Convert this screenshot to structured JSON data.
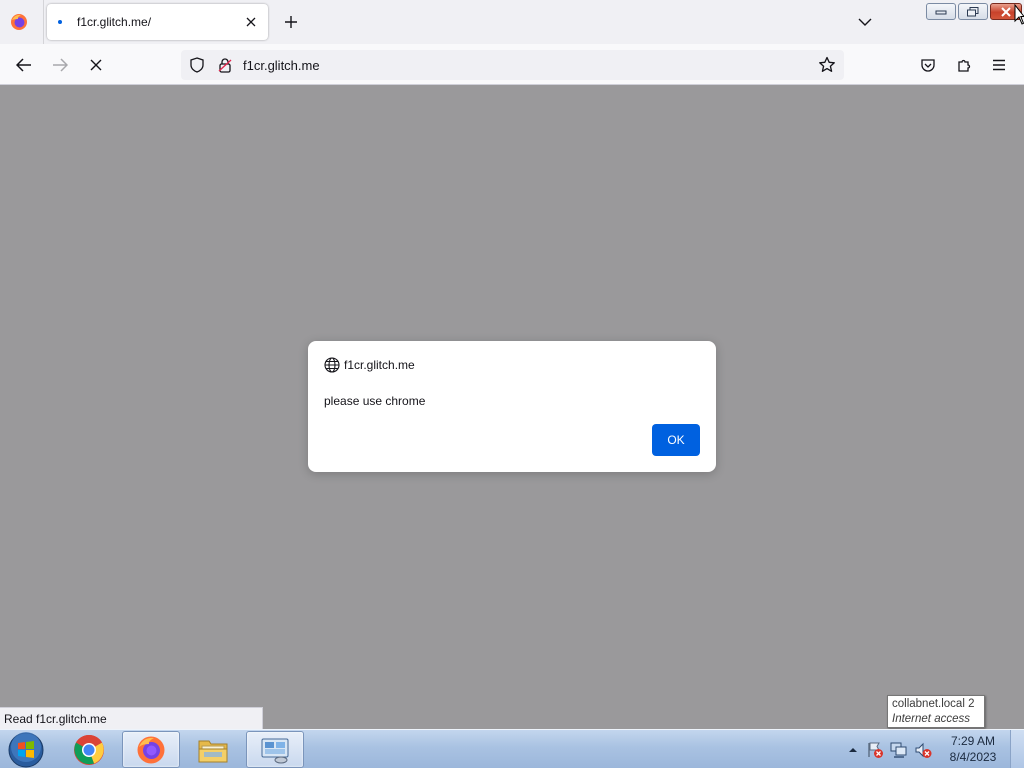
{
  "browser": {
    "tab": {
      "title": "f1cr.glitch.me/"
    },
    "url": "f1cr.glitch.me",
    "status_text": "Read f1cr.glitch.me"
  },
  "dialog": {
    "origin": "f1cr.glitch.me",
    "message": "please use chrome",
    "ok_label": "OK"
  },
  "tooltip": {
    "line1": "collabnet.local  2",
    "line2": "Internet access"
  },
  "taskbar": {
    "time": "7:29 AM",
    "date": "8/4/2023",
    "apps": [
      "chrome-icon",
      "firefox-icon",
      "file-explorer-icon",
      "control-panel-icon"
    ]
  },
  "colors": {
    "content_bg": "#9a999b",
    "accent": "#0061e0"
  }
}
